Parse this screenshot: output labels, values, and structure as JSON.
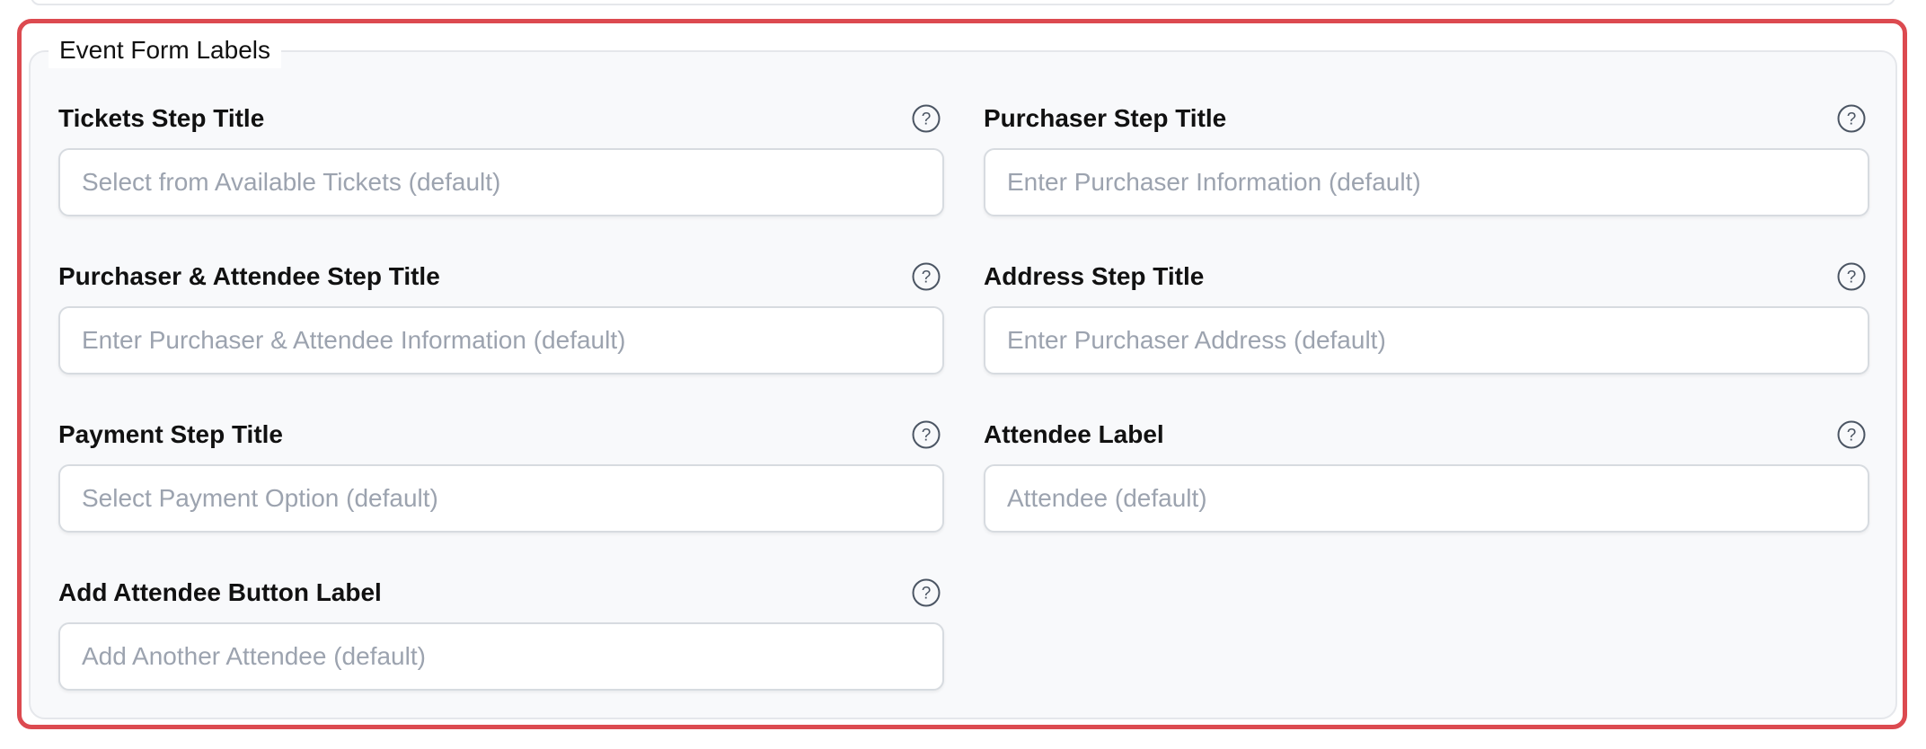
{
  "section": {
    "title": "Event Form Labels"
  },
  "fields": [
    {
      "label": "Tickets Step Title",
      "placeholder": "Select from Available Tickets (default)",
      "value": "",
      "icon": "help-circle-icon"
    },
    {
      "label": "Purchaser Step Title",
      "placeholder": "Enter Purchaser Information (default)",
      "value": "",
      "icon": "help-circle-icon"
    },
    {
      "label": "Purchaser & Attendee Step Title",
      "placeholder": "Enter Purchaser & Attendee Information (default)",
      "value": "",
      "icon": "help-circle-icon"
    },
    {
      "label": "Address Step Title",
      "placeholder": "Enter Purchaser Address (default)",
      "value": "",
      "icon": "help-circle-icon"
    },
    {
      "label": "Payment Step Title",
      "placeholder": "Select Payment Option (default)",
      "value": "",
      "icon": "help-circle-icon"
    },
    {
      "label": "Attendee Label",
      "placeholder": "Attendee (default)",
      "value": "",
      "icon": "help-circle-icon"
    },
    {
      "label": "Add Attendee Button Label",
      "placeholder": "Add Another Attendee (default)",
      "value": "",
      "icon": "help-circle-icon"
    }
  ],
  "colors": {
    "highlight_border": "#dc4a50",
    "panel_background": "#f8f9fb",
    "placeholder_text": "#9ca3af"
  }
}
